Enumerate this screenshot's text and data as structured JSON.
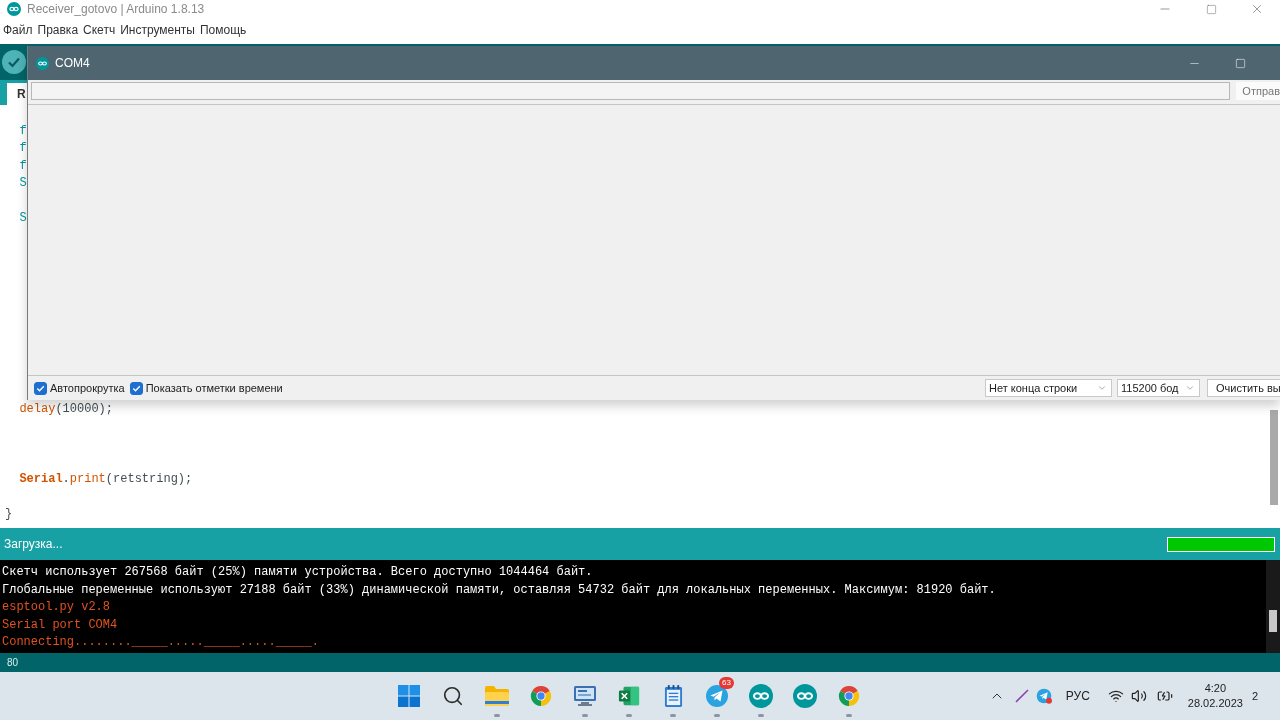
{
  "window": {
    "title": "Receiver_gotovo | Arduino 1.8.13"
  },
  "menu": [
    {
      "label": "Файл"
    },
    {
      "label": "Правка"
    },
    {
      "label": "Скетч"
    },
    {
      "label": "Инструменты"
    },
    {
      "label": "Помощь"
    }
  ],
  "tabs": [
    {
      "label": "R",
      "selected": true
    }
  ],
  "editor": {
    "lines": [
      {
        "indented": true,
        "segments": [
          {
            "text": "f",
            "kind": "type"
          }
        ]
      },
      {
        "indented": true,
        "segments": [
          {
            "text": "f",
            "kind": "type"
          }
        ]
      },
      {
        "indented": true,
        "segments": [
          {
            "text": "f",
            "kind": "type"
          }
        ]
      },
      {
        "indented": true,
        "segments": [
          {
            "text": "S",
            "kind": "type"
          }
        ]
      },
      {
        "indented": true,
        "segments": [
          {
            "text": "S",
            "kind": "type"
          }
        ]
      },
      {
        "indented": true,
        "segments": [
          {
            "text": "delay",
            "kind": "function"
          },
          {
            "text": "(10000);",
            "kind": "plain"
          }
        ]
      },
      {
        "indented": true,
        "segments": [
          {
            "text": "Serial",
            "kind": "keyword"
          },
          {
            "text": ".",
            "kind": "plain"
          },
          {
            "text": "print",
            "kind": "function"
          },
          {
            "text": "(retstring);",
            "kind": "plain"
          }
        ]
      },
      {
        "indented": false,
        "segments": [
          {
            "text": "}",
            "kind": "plain"
          }
        ]
      }
    ]
  },
  "status": {
    "message": "Загрузка...",
    "progress": {
      "level": 1
    }
  },
  "console": {
    "lines": [
      {
        "text": "Скетч использует 267568 байт (25%) памяти устройства. Всего доступно 1044464 байт.",
        "kind": "info"
      },
      {
        "text": "Глобальные переменные используют 27188 байт (33%) динамической памяти, оставляя 54732 байт для локальных переменных. Максимум: 81920 байт.",
        "kind": "info"
      },
      {
        "text": "esptool.py v2.8",
        "kind": "error"
      },
      {
        "text": "Serial port COM4",
        "kind": "error"
      },
      {
        "text": "Connecting........_____....._____....._____.",
        "kind": "error"
      }
    ]
  },
  "status_bar": {
    "line": "80"
  },
  "serial_monitor": {
    "title": "COM4",
    "send_button": "Отправ",
    "checkboxes": [
      {
        "label": "Автопрокрутка",
        "checked": true
      },
      {
        "label": "Показать отметки времени",
        "checked": true
      }
    ],
    "line_ending": "Нет конца строки",
    "baud_rate": "115200 бод",
    "clear_button": "Очистить вы"
  },
  "taskbar": {
    "items": [
      {
        "kind": "start",
        "running": false
      },
      {
        "kind": "search",
        "running": false
      },
      {
        "kind": "files",
        "running": true
      },
      {
        "kind": "browser",
        "running": false
      },
      {
        "kind": "remote",
        "running": true
      },
      {
        "kind": "spreadsheet",
        "running": true
      },
      {
        "kind": "notes",
        "running": true
      },
      {
        "kind": "messenger",
        "running": true,
        "badge": "63"
      },
      {
        "kind": "ide",
        "running": true
      },
      {
        "kind": "ide",
        "running": false
      },
      {
        "kind": "browser",
        "running": true
      }
    ],
    "tray": {
      "language": "РУС",
      "time": "4:20",
      "date": "28.02.2023",
      "notifications": "2"
    }
  }
}
